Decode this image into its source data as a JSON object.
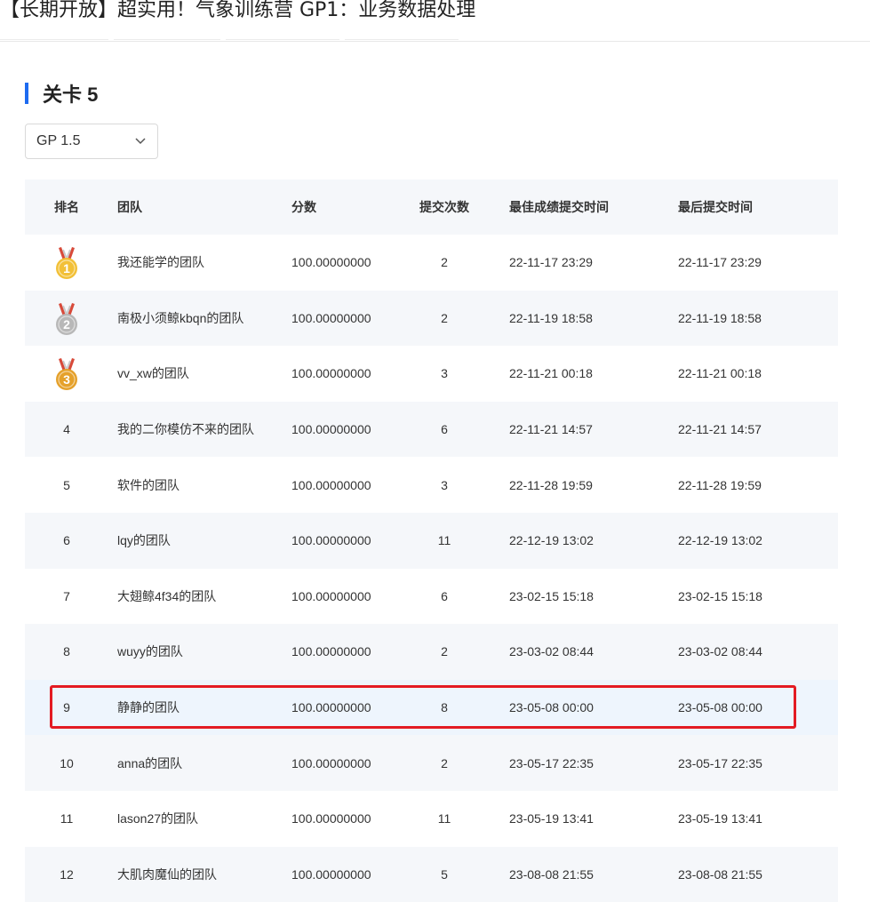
{
  "page": {
    "title": "【长期开放】超实用！气象训练营 GP1：业务数据处理"
  },
  "section": {
    "title": "关卡 5"
  },
  "version_select": {
    "value": "GP 1.5"
  },
  "table": {
    "headers": {
      "rank": "排名",
      "team": "团队",
      "score": "分数",
      "count": "提交次数",
      "best_time": "最佳成绩提交时间",
      "last_time": "最后提交时间"
    },
    "rows": [
      {
        "rank": "1",
        "medal": "gold-medal-icon",
        "team": "我还能学的团队",
        "score": "100.00000000",
        "count": "2",
        "best": "22-11-17 23:29",
        "last": "22-11-17 23:29"
      },
      {
        "rank": "2",
        "medal": "silver-medal-icon",
        "team": "南极小须鲸kbqn的团队",
        "score": "100.00000000",
        "count": "2",
        "best": "22-11-19 18:58",
        "last": "22-11-19 18:58"
      },
      {
        "rank": "3",
        "medal": "bronze-medal-icon",
        "team": "vv_xw的团队",
        "score": "100.00000000",
        "count": "3",
        "best": "22-11-21 00:18",
        "last": "22-11-21 00:18"
      },
      {
        "rank": "4",
        "team": "我的二你模仿不来的团队",
        "score": "100.00000000",
        "count": "6",
        "best": "22-11-21 14:57",
        "last": "22-11-21 14:57"
      },
      {
        "rank": "5",
        "team": "软件的团队",
        "score": "100.00000000",
        "count": "3",
        "best": "22-11-28 19:59",
        "last": "22-11-28 19:59"
      },
      {
        "rank": "6",
        "team": "lqy的团队",
        "score": "100.00000000",
        "count": "11",
        "best": "22-12-19 13:02",
        "last": "22-12-19 13:02"
      },
      {
        "rank": "7",
        "team": "大翅鲸4f34的团队",
        "score": "100.00000000",
        "count": "6",
        "best": "23-02-15 15:18",
        "last": "23-02-15 15:18"
      },
      {
        "rank": "8",
        "team": "wuyy的团队",
        "score": "100.00000000",
        "count": "2",
        "best": "23-03-02 08:44",
        "last": "23-03-02 08:44"
      },
      {
        "rank": "9",
        "team": "静静的团队",
        "score": "100.00000000",
        "count": "8",
        "best": "23-05-08 00:00",
        "last": "23-05-08 00:00"
      },
      {
        "rank": "10",
        "team": "anna的团队",
        "score": "100.00000000",
        "count": "2",
        "best": "23-05-17 22:35",
        "last": "23-05-17 22:35"
      },
      {
        "rank": "11",
        "team": "lason27的团队",
        "score": "100.00000000",
        "count": "11",
        "best": "23-05-19 13:41",
        "last": "23-05-19 13:41"
      },
      {
        "rank": "12",
        "team": "大肌肉魔仙的团队",
        "score": "100.00000000",
        "count": "5",
        "best": "23-08-08 21:55",
        "last": "23-08-08 21:55"
      }
    ]
  },
  "colors": {
    "accent": "#1e6bf0",
    "highlight_border": "#e31b23",
    "gold": "#f2c037",
    "silver": "#b8b8b8",
    "bronze": "#e5a12b"
  }
}
